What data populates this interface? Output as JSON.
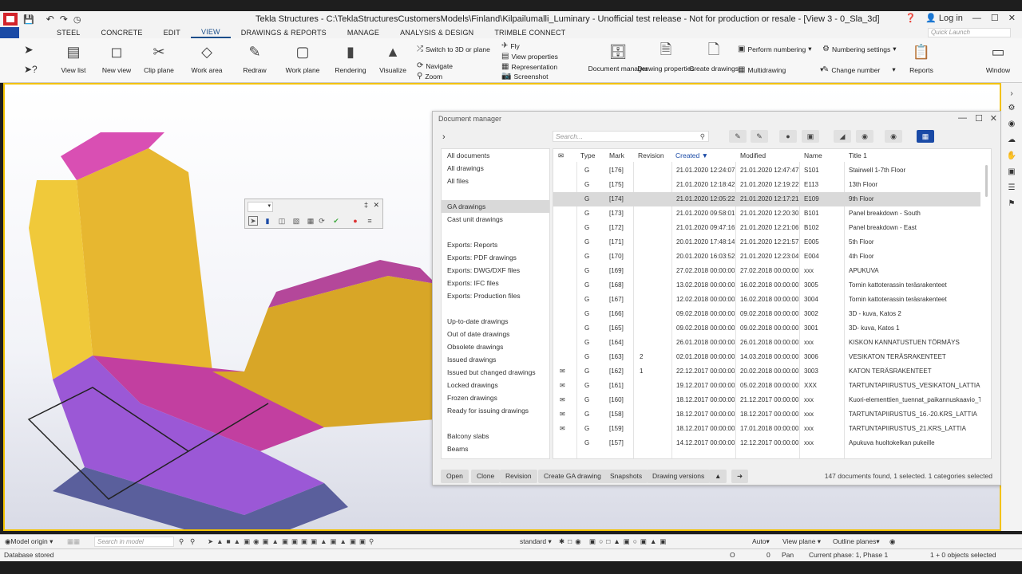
{
  "window": {
    "title": "Tekla Structures - C:\\TeklaStructuresCustomersModels\\Finland\\Kilpailumalli_Luminary  - Unofficial test release - Not for production or resale - [View 3 - 0_Sla_3d]",
    "login": "Log in"
  },
  "menu": {
    "tabs": [
      "STEEL",
      "CONCRETE",
      "EDIT",
      "VIEW",
      "DRAWINGS & REPORTS",
      "MANAGE",
      "ANALYSIS & DESIGN",
      "TRIMBLE CONNECT"
    ],
    "active_tab": "VIEW",
    "quick_launch_placeholder": "Quick Launch"
  },
  "ribbon": {
    "view_list": "View list",
    "new_view": "New view",
    "clip_plane": "Clip plane",
    "work_area": "Work area",
    "redraw": "Redraw",
    "work_plane": "Work plane",
    "rendering": "Rendering",
    "visualize": "Visualize",
    "switch_3d": "Switch to 3D or plane",
    "navigate": "Navigate",
    "zoom": "Zoom",
    "fly": "Fly",
    "view_properties": "View properties",
    "representation": "Representation",
    "screenshot": "Screenshot",
    "document_manager": "Document manager",
    "drawing_properties": "Drawing properties",
    "create_drawings": "Create drawings",
    "perform_numbering": "Perform numbering",
    "multidrawing": "Multidrawing",
    "numbering_settings": "Numbering settings",
    "change_number": "Change number",
    "reports": "Reports",
    "window": "Window"
  },
  "document_manager": {
    "title": "Document manager",
    "search_placeholder": "Search...",
    "categories": [
      "All documents",
      "All drawings",
      "All files",
      "",
      "GA drawings",
      "Cast unit drawings",
      "",
      "Exports: Reports",
      "Exports: PDF drawings",
      "Exports: DWG/DXF files",
      "Exports: IFC files",
      "Exports: Production files",
      "",
      "Up-to-date drawings",
      "Out of date drawings",
      "Obsolete drawings",
      "Issued drawings",
      "Issued but changed drawings",
      "Locked drawings",
      "Frozen drawings",
      "Ready for issuing drawings",
      "",
      "Balcony slabs",
      "Beams"
    ],
    "selected_category": "GA drawings",
    "columns": [
      "Type",
      "Mark",
      "Revision",
      "Created",
      "Modified",
      "Name",
      "Title 1"
    ],
    "sorted_column": "Created",
    "rows": [
      {
        "icon": false,
        "type": "G",
        "mark": "[176]",
        "revision": "",
        "created": "21.01.2020 12:24:07",
        "modified": "21.01.2020 12:47:47",
        "name": "S101",
        "title": "Stairwell 1-7th Floor"
      },
      {
        "icon": false,
        "type": "G",
        "mark": "[175]",
        "revision": "",
        "created": "21.01.2020 12:18:42",
        "modified": "21.01.2020 12:19:22",
        "name": "E113",
        "title": "13th Floor"
      },
      {
        "icon": false,
        "type": "G",
        "mark": "[174]",
        "revision": "",
        "created": "21.01.2020 12:05:22",
        "modified": "21.01.2020 12:17:21",
        "name": "E109",
        "title": "9th Floor"
      },
      {
        "icon": false,
        "type": "G",
        "mark": "[173]",
        "revision": "",
        "created": "21.01.2020 09:58:01",
        "modified": "21.01.2020 12:20:30",
        "name": "B101",
        "title": "Panel breakdown - South"
      },
      {
        "icon": false,
        "type": "G",
        "mark": "[172]",
        "revision": "",
        "created": "21.01.2020 09:47:16",
        "modified": "21.01.2020 12:21:06",
        "name": "B102",
        "title": "Panel breakdown - East"
      },
      {
        "icon": false,
        "type": "G",
        "mark": "[171]",
        "revision": "",
        "created": "20.01.2020 17:48:14",
        "modified": "21.01.2020 12:21:57",
        "name": "E005",
        "title": "5th Floor"
      },
      {
        "icon": false,
        "type": "G",
        "mark": "[170]",
        "revision": "",
        "created": "20.01.2020 16:03:52",
        "modified": "21.01.2020 12:23:04",
        "name": "E004",
        "title": "4th Floor"
      },
      {
        "icon": false,
        "type": "G",
        "mark": "[169]",
        "revision": "",
        "created": "27.02.2018 00:00:00",
        "modified": "27.02.2018 00:00:00",
        "name": "xxx",
        "title": "APUKUVA"
      },
      {
        "icon": false,
        "type": "G",
        "mark": "[168]",
        "revision": "",
        "created": "13.02.2018 00:00:00",
        "modified": "16.02.2018 00:00:00",
        "name": "3005",
        "title": "Tornin kattoterassin teräsrakenteet"
      },
      {
        "icon": false,
        "type": "G",
        "mark": "[167]",
        "revision": "",
        "created": "12.02.2018 00:00:00",
        "modified": "16.02.2018 00:00:00",
        "name": "3004",
        "title": "Tornin kattoterassin teräsrakenteet"
      },
      {
        "icon": false,
        "type": "G",
        "mark": "[166]",
        "revision": "",
        "created": "09.02.2018 00:00:00",
        "modified": "09.02.2018 00:00:00",
        "name": "3002",
        "title": "3D - kuva, Katos 2"
      },
      {
        "icon": false,
        "type": "G",
        "mark": "[165]",
        "revision": "",
        "created": "09.02.2018 00:00:00",
        "modified": "09.02.2018 00:00:00",
        "name": "3001",
        "title": "3D- kuva, Katos 1"
      },
      {
        "icon": false,
        "type": "G",
        "mark": "[164]",
        "revision": "",
        "created": "26.01.2018 00:00:00",
        "modified": "26.01.2018 00:00:00",
        "name": "xxx",
        "title": "KISKON KANNATUSTUEN TÖRMÄYS"
      },
      {
        "icon": false,
        "type": "G",
        "mark": "[163]",
        "revision": "2",
        "created": "02.01.2018 00:00:00",
        "modified": "14.03.2018 00:00:00",
        "name": "3006",
        "title": "VESIKATON TERÄSRAKENTEET"
      },
      {
        "icon": true,
        "type": "G",
        "mark": "[162]",
        "revision": "1",
        "created": "22.12.2017 00:00:00",
        "modified": "20.02.2018 00:00:00",
        "name": "3003",
        "title": "KATON TERÄSRAKENTEET"
      },
      {
        "icon": true,
        "type": "G",
        "mark": "[161]",
        "revision": "",
        "created": "19.12.2017 00:00:00",
        "modified": "05.02.2018 00:00:00",
        "name": "XXX",
        "title": "TARTUNTAPIIRUSTUS_VESIKATON_LATTIA"
      },
      {
        "icon": true,
        "type": "G",
        "mark": "[160]",
        "revision": "",
        "created": "18.12.2017 00:00:00",
        "modified": "21.12.2017 00:00:00",
        "name": "xxx",
        "title": "Kuori-elementtien_tuennat_paikannuskaavio_Te"
      },
      {
        "icon": true,
        "type": "G",
        "mark": "[158]",
        "revision": "",
        "created": "18.12.2017 00:00:00",
        "modified": "18.12.2017 00:00:00",
        "name": "xxx",
        "title": "TARTUNTAPIIRUSTUS_16.-20.KRS_LATTIA"
      },
      {
        "icon": true,
        "type": "G",
        "mark": "[159]",
        "revision": "",
        "created": "18.12.2017 00:00:00",
        "modified": "17.01.2018 00:00:00",
        "name": "xxx",
        "title": "TARTUNTAPIIRUSTUS_21.KRS_LATTIA"
      },
      {
        "icon": false,
        "type": "G",
        "mark": "[157]",
        "revision": "",
        "created": "14.12.2017 00:00:00",
        "modified": "12.12.2017 00:00:00",
        "name": "xxx",
        "title": "Apukuva huoltokelkan pukeille"
      }
    ],
    "buttons": [
      "Open",
      "Clone",
      "Revision",
      "Create GA drawing",
      "Snapshots",
      "Drawing versions"
    ],
    "status": "147 documents found, 1 selected. 1 categories selected"
  },
  "bottom_toolbar": {
    "model_origin": "Model origin",
    "search_placeholder": "Search in model",
    "standard": "standard",
    "auto": "Auto",
    "view_plane": "View plane",
    "outline_planes": "Outline planes"
  },
  "status_bar": {
    "left": "Database stored",
    "o": "O",
    "zero": "0",
    "pan": "Pan",
    "phase": "Current phase: 1, Phase 1",
    "selected": "1 + 0 objects selected"
  },
  "colors": {
    "accent": "#1a4aa6",
    "viewport_border": "#f3c200",
    "brand": "#d2232a"
  }
}
